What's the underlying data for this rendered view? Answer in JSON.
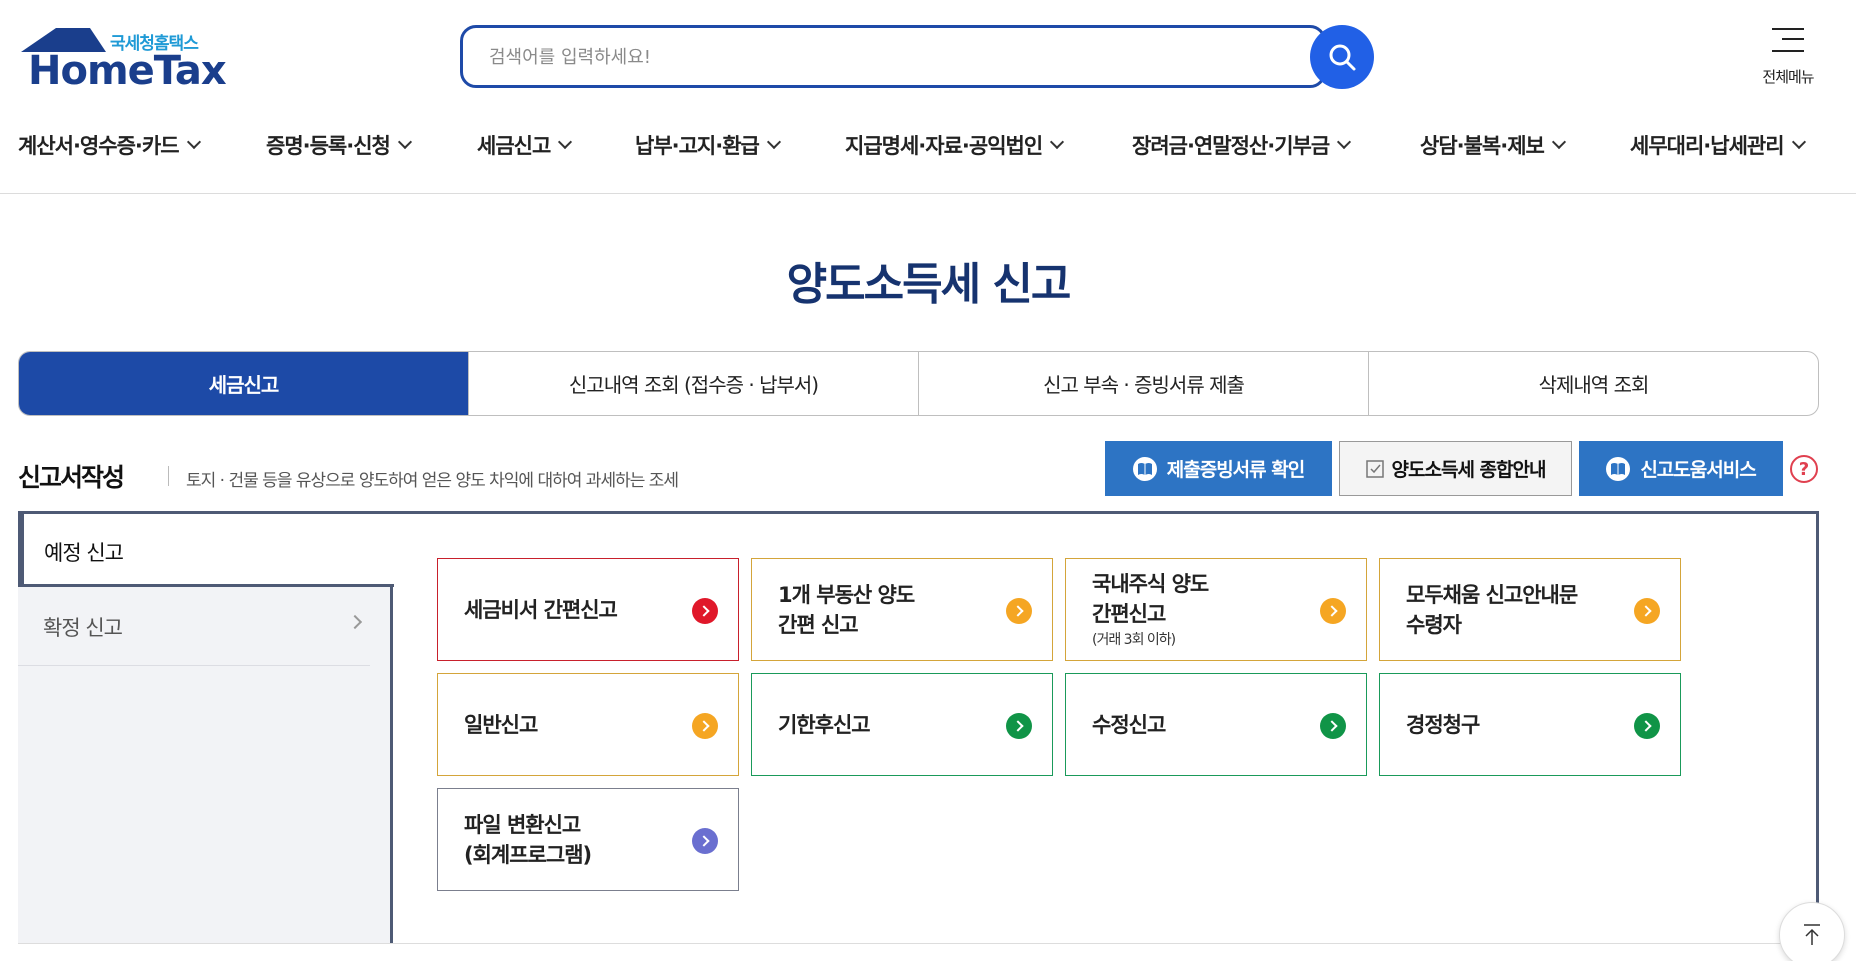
{
  "header": {
    "logo_ko": "국세청홈택스",
    "logo_en": "HomeTax",
    "search_placeholder": "검색어를 입력하세요!",
    "all_menu_label": "전체메뉴"
  },
  "gnb": [
    {
      "label": "계산서·영수증·카드"
    },
    {
      "label": "증명·등록·신청"
    },
    {
      "label": "세금신고"
    },
    {
      "label": "납부·고지·환급"
    },
    {
      "label": "지급명세·자료·공익법인"
    },
    {
      "label": "장려금·연말정산·기부금"
    },
    {
      "label": "상담·불복·제보"
    },
    {
      "label": "세무대리·납세관리"
    }
  ],
  "page_title": "양도소득세 신고",
  "tabs": [
    {
      "label": "세금신고",
      "active": true
    },
    {
      "label": "신고내역 조회 (접수증 · 납부서)",
      "active": false
    },
    {
      "label": "신고 부속 · 증빙서류 제출",
      "active": false
    },
    {
      "label": "삭제내역 조회",
      "active": false
    }
  ],
  "section": {
    "title": "신고서작성",
    "description": "토지 · 건물 등을 유상으로 양도하여 얻은 양도 차익에 대하여 과세하는 조세",
    "btn_evidence": "제출증빙서류 확인",
    "btn_guide": "양도소득세 종합안내",
    "btn_help_service": "신고도움서비스",
    "help_mark": "?"
  },
  "side_menu": [
    {
      "label": "예정 신고",
      "active": true
    },
    {
      "label": "확정 신고",
      "active": false
    }
  ],
  "cards": [
    {
      "label": "세금비서 간편신고",
      "sub": "",
      "border": "#c8202c",
      "arrow": "#e0182a"
    },
    {
      "label": "1개 부동산 양도\n간편 신고",
      "sub": "",
      "border": "#d4a53a",
      "arrow": "#f5a623"
    },
    {
      "label": "국내주식 양도\n간편신고",
      "sub": "(거래 3회 이하)",
      "border": "#d4a53a",
      "arrow": "#f5a623"
    },
    {
      "label": "모두채움 신고안내문\n수령자",
      "sub": "",
      "border": "#d4a53a",
      "arrow": "#f5a623"
    },
    {
      "label": "일반신고",
      "sub": "",
      "border": "#d4a53a",
      "arrow": "#f5a623"
    },
    {
      "label": "기한후신고",
      "sub": "",
      "border": "#1a9a5a",
      "arrow": "#109447"
    },
    {
      "label": "수정신고",
      "sub": "",
      "border": "#1a9a5a",
      "arrow": "#109447"
    },
    {
      "label": "경정청구",
      "sub": "",
      "border": "#1a9a5a",
      "arrow": "#109447"
    },
    {
      "label": "파일 변환신고\n(회계프로그램)",
      "sub": "",
      "border": "#7b7f8e",
      "arrow": "#6a6fd0"
    }
  ],
  "colors": {
    "brand_navy": "#16336f",
    "tab_active": "#1d4aa7",
    "search_button": "#2160e6",
    "blue_button": "#2d74c4"
  }
}
